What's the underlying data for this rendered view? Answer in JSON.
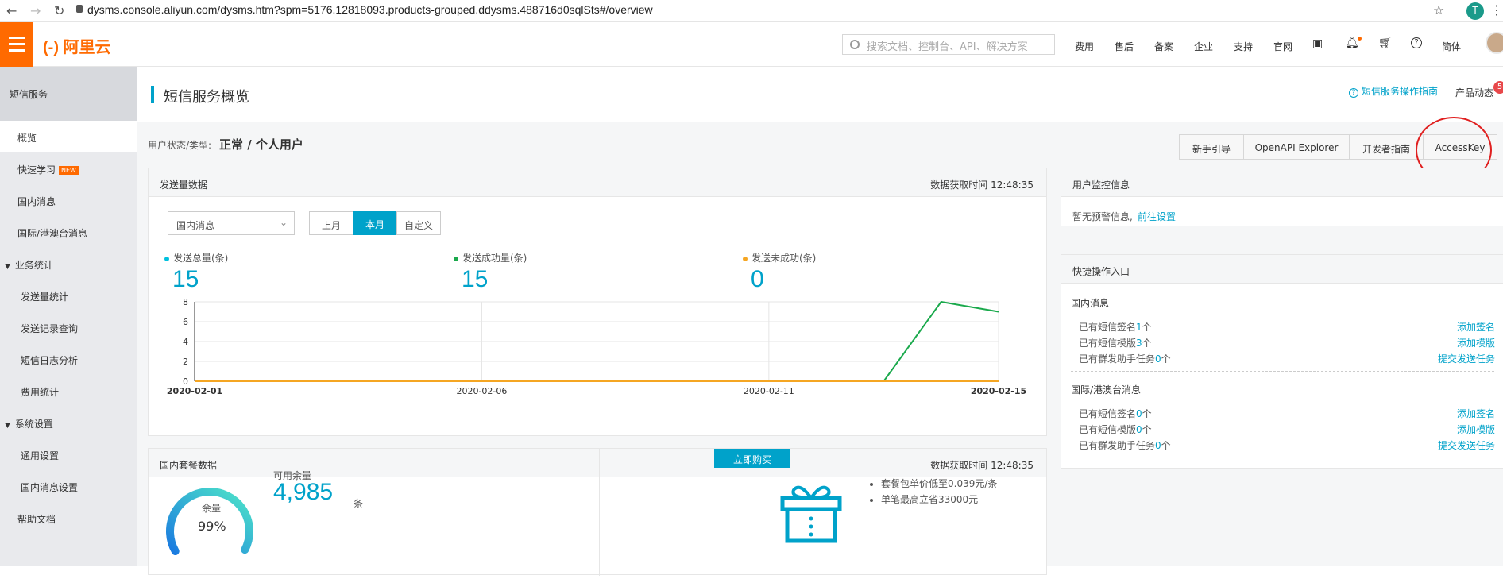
{
  "browser": {
    "url": "dysms.console.aliyun.com/dysms.htm?spm=5176.12818093.products-grouped.ddysms.488716d0sqlSts#/overview",
    "avatar_letter": "T"
  },
  "header": {
    "logo": "(-) 阿里云",
    "search_placeholder": "搜索文档、控制台、API、解决方案",
    "nav": [
      "费用",
      "售后",
      "备案",
      "企业",
      "支持",
      "官网"
    ],
    "lang": "简体"
  },
  "sidebar": {
    "title": "短信服务",
    "items": [
      {
        "label": "概览",
        "active": true
      },
      {
        "label": "快速学习",
        "badge": "NEW"
      },
      {
        "label": "国内消息"
      },
      {
        "label": "国际/港澳台消息"
      }
    ],
    "groups": [
      {
        "label": "业务统计",
        "children": [
          "发送量统计",
          "发送记录查询",
          "短信日志分析",
          "费用统计"
        ]
      },
      {
        "label": "系统设置",
        "children": [
          "通用设置",
          "国内消息设置"
        ]
      }
    ],
    "help": "帮助文档"
  },
  "page": {
    "title": "短信服务概览",
    "guide_link": "短信服务操作指南",
    "product_news": "产品动态",
    "news_count": "5",
    "user_status_label": "用户状态/类型:",
    "user_status_value": "正常 / 个人用户",
    "quick_buttons": [
      "新手引导",
      "OpenAPI Explorer",
      "开发者指南",
      "AccessKey"
    ]
  },
  "send_panel": {
    "title": "发送量数据",
    "fetch_time": "数据获取时间 12:48:35",
    "select_value": "国内消息",
    "tabs": [
      "上月",
      "本月",
      "自定义"
    ],
    "active_tab": "本月",
    "stats": [
      {
        "label": "发送总量(条)",
        "value": "15",
        "color": "#00c1de"
      },
      {
        "label": "发送成功量(条)",
        "value": "15",
        "color": "#1aa94c"
      },
      {
        "label": "发送未成功(条)",
        "value": "0",
        "color": "#f5a623"
      }
    ]
  },
  "chart_data": {
    "type": "line",
    "x_ticks": [
      "2020-02-01",
      "2020-02-06",
      "2020-02-11",
      "2020-02-15"
    ],
    "ylim": [
      0,
      8
    ],
    "y_ticks": [
      "0",
      "2",
      "4",
      "6",
      "8"
    ],
    "series": [
      {
        "color": "#1aa94c",
        "points": [
          [
            0,
            0
          ],
          [
            12,
            0
          ],
          [
            13,
            8
          ],
          [
            14,
            7
          ]
        ]
      },
      {
        "color": "#f5a623",
        "points": [
          [
            0,
            0
          ],
          [
            14,
            0
          ]
        ]
      }
    ]
  },
  "package_panel": {
    "title": "国内套餐数据",
    "fetch_time": "数据获取时间 12:48:35",
    "gauge_label": "余量",
    "gauge_percent": "99%",
    "gauge_fraction": 0.99,
    "available_label": "可用余量",
    "available_value": "4,985",
    "available_unit": "条",
    "buy_button": "立即购买",
    "bullets": [
      "套餐包单价低至0.039元/条",
      "单笔最高立省33000元"
    ]
  },
  "monitor_panel": {
    "title": "用户监控信息",
    "text": "暂无预警信息,",
    "link": "前往设置"
  },
  "quick_panel": {
    "title": "快捷操作入口",
    "sections": [
      {
        "title": "国内消息",
        "rows": [
          {
            "pre": "已有短信签名",
            "n": "1",
            "post": "个",
            "action": "添加签名"
          },
          {
            "pre": "已有短信模版",
            "n": "3",
            "post": "个",
            "action": "添加模版"
          },
          {
            "pre": "已有群发助手任务",
            "n": "0",
            "post": "个",
            "action": "提交发送任务"
          }
        ]
      },
      {
        "title": "国际/港澳台消息",
        "rows": [
          {
            "pre": "已有短信签名",
            "n": "0",
            "post": "个",
            "action": "添加签名"
          },
          {
            "pre": "已有短信模版",
            "n": "0",
            "post": "个",
            "action": "添加模版"
          },
          {
            "pre": "已有群发助手任务",
            "n": "0",
            "post": "个",
            "action": "提交发送任务"
          }
        ]
      }
    ]
  }
}
